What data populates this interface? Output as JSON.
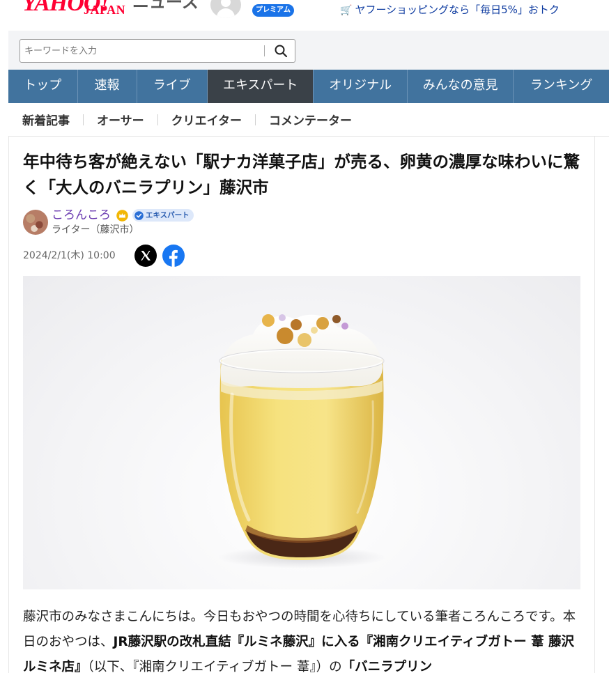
{
  "header": {
    "logo_main": "YAHOO!",
    "logo_sub": "JAPAN",
    "logo_service": "ニュース",
    "premium_badge": "プレミアム",
    "promo_text": "ヤフーショッピングなら「毎日5%」おトク",
    "promo_icon": "cart-icon"
  },
  "search": {
    "placeholder": "キーワードを入力",
    "value": "",
    "icon": "search-icon"
  },
  "mainnav": {
    "tabs": [
      {
        "label": "トップ",
        "active": false
      },
      {
        "label": "速報",
        "active": false
      },
      {
        "label": "ライブ",
        "active": false
      },
      {
        "label": "エキスパート",
        "active": true
      },
      {
        "label": "オリジナル",
        "active": false
      },
      {
        "label": "みんなの意見",
        "active": false
      },
      {
        "label": "ランキング",
        "active": false
      }
    ]
  },
  "subnav": {
    "items": [
      "新着記事",
      "オーサー",
      "クリエイター",
      "コメンテーター"
    ]
  },
  "article": {
    "title": "年中待ち客が絶えない「駅ナカ洋菓子店」が売る、卵黄の濃厚な味わいに驚く「大人のバニラプリン」藤沢市",
    "author_name": "ころんころ",
    "author_badge": "エキスパート",
    "author_role": "ライター（藤沢市）",
    "date": "2024/2/1(木) 10:00",
    "share": [
      "x-icon",
      "facebook-icon"
    ],
    "body": {
      "p1_a": "藤沢市のみなさまこんにちは。今日もおやつの時間を心待ちにしている筆者ころんころです。本日のおやつは、",
      "p1_b": "JR藤沢駅の改札直結『ルミネ藤沢』に入る『湘南クリエイティブガトー 葦 藤沢ルミネ店』",
      "p1_c": "（以下、『湘南クリエイティブガトー 葦』）の",
      "p1_d": "「バニラプリン"
    }
  },
  "colors": {
    "brand_red": "#ff0033",
    "nav_blue": "#41739e",
    "nav_active": "#3a4148",
    "author_purple": "#6a3ab0",
    "link_blue": "#0f3ca0"
  }
}
